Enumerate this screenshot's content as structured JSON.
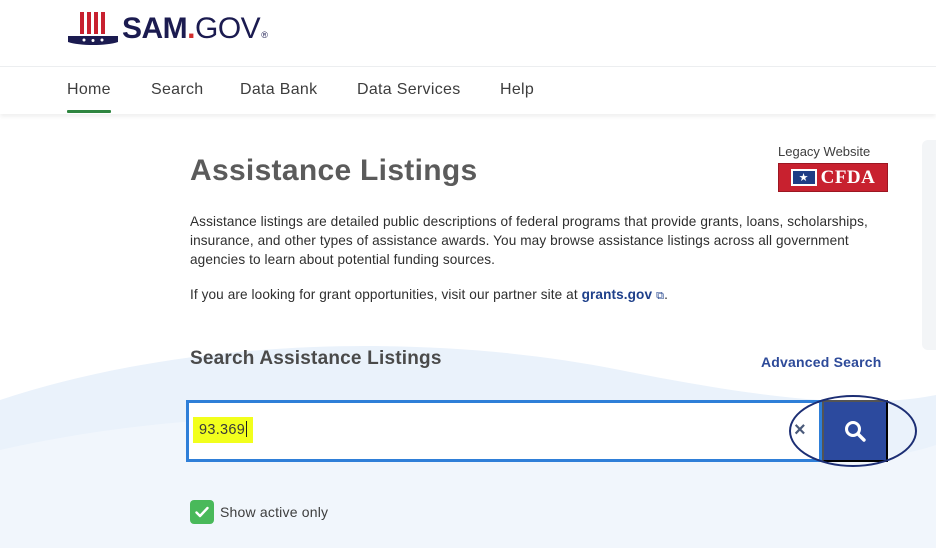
{
  "header": {
    "logo": {
      "sam": "SAM",
      "dot": ".",
      "gov": "GOV",
      "reg": "®"
    },
    "nav": [
      {
        "label": "Home",
        "active": true
      },
      {
        "label": "Search",
        "active": false
      },
      {
        "label": "Data Bank",
        "active": false
      },
      {
        "label": "Data Services",
        "active": false
      },
      {
        "label": "Help",
        "active": false
      }
    ]
  },
  "main": {
    "title": "Assistance Listings",
    "legacy": {
      "label": "Legacy Website",
      "badge_text": "CFDA"
    },
    "description": "Assistance listings are detailed public descriptions of federal programs that provide grants, loans, scholarships, insurance, and other types of assistance awards. You may browse assistance listings across all government agencies to learn about potential funding sources.",
    "partner": {
      "text": "If you are looking for grant opportunities, visit our partner site at",
      "link": "grants.gov",
      "suffix": "."
    },
    "search": {
      "heading": "Search Assistance Listings",
      "advanced_label": "Advanced Search",
      "value": "93.369",
      "clear_glyph": "×"
    },
    "filter": {
      "label": "Show active only",
      "checked": true
    }
  },
  "colors": {
    "nav_active": "#2e8540",
    "search_border": "#2f7fd8",
    "search_button": "#2c4a9e",
    "highlight": "#f2ff1c",
    "link": "#1d3f8a",
    "checkbox": "#49b95a",
    "cfda_red": "#c8212f"
  }
}
